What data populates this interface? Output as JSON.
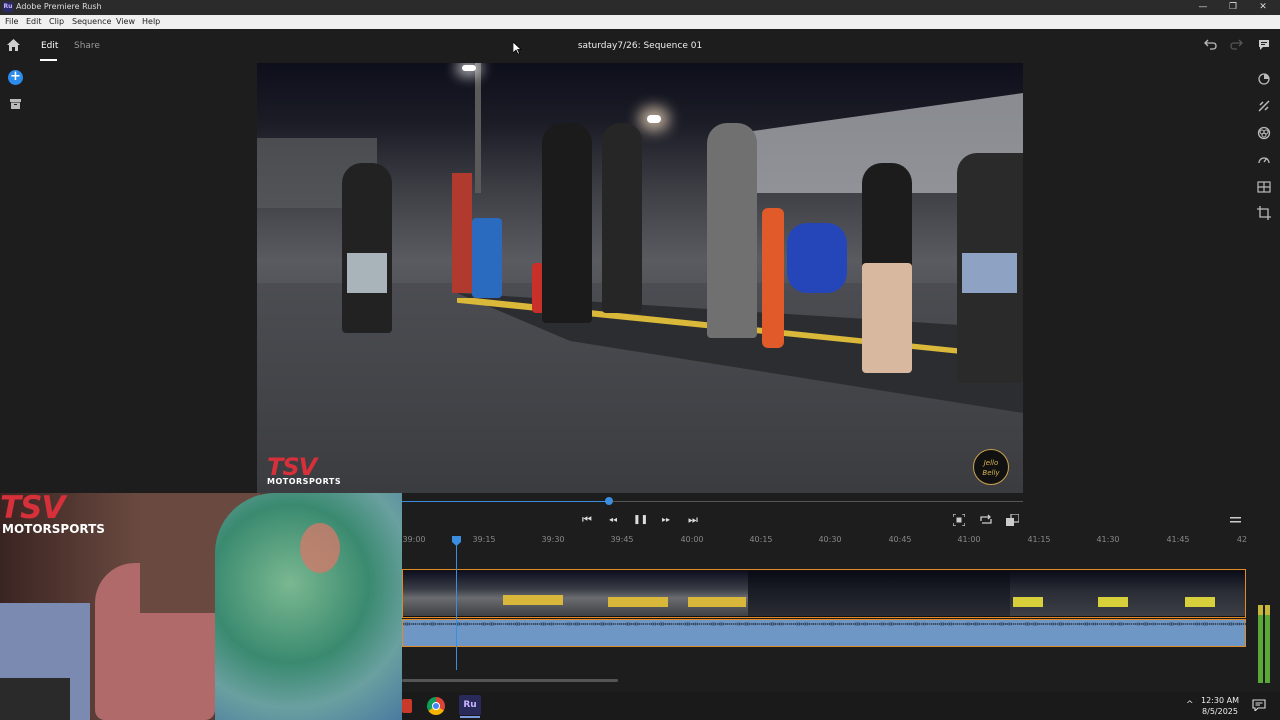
{
  "window": {
    "app_icon_label": "Ru",
    "title": "Adobe Premiere Rush",
    "minimize": "—",
    "restore": "❐",
    "close": "✕"
  },
  "menubar": [
    "File",
    "Edit",
    "Clip",
    "Sequence",
    "View",
    "Help"
  ],
  "header": {
    "tabs": [
      {
        "label": "Edit",
        "active": true
      },
      {
        "label": "Share",
        "active": false
      }
    ],
    "sequence_title": "saturday7/26: Sequence 01"
  },
  "left_rail": {
    "add_icon": "plus-icon",
    "media_icon": "archive-icon"
  },
  "right_rail": [
    "transitions-icon",
    "effects-icon",
    "color-icon",
    "speed-icon",
    "layout-icon",
    "crop-icon"
  ],
  "preview": {
    "watermark_brand": "TSV",
    "watermark_sub": "MOTORSPORTS",
    "corner_logo": "Jello Belly",
    "progress": 0.33
  },
  "transport": {
    "skip_back": "⏮",
    "step_back": "◂◂",
    "pause": "❚❚",
    "step_forward": "▸▸",
    "skip_forward": "⏭"
  },
  "timeline": {
    "ticks": [
      "39:00",
      "39:15",
      "39:30",
      "39:45",
      "40:00",
      "40:15",
      "40:30",
      "40:45",
      "41:00",
      "41:15",
      "41:30",
      "41:45",
      "42"
    ],
    "playhead": "39:15"
  },
  "webcam": {
    "brand": "TSV",
    "sub": "MOTORSPORTS"
  },
  "taskbar": {
    "ru_label": "Ru",
    "time": "12:30 AM",
    "date": "8/5/2025",
    "chevron": "^"
  },
  "colors": {
    "accent": "#2d8ceb",
    "clip_border": "#e08a2a",
    "audio": "#6e97c6",
    "brand_red": "#d6303b"
  }
}
